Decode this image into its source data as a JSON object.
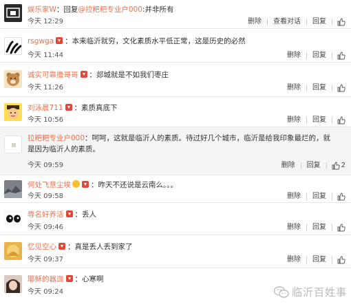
{
  "comments": [
    {
      "user": "娱乐家W",
      "vip": false,
      "separator": "：",
      "reply_prefix": "回复",
      "mention": "@拉粑粑专业户000",
      "text_after": ":并非所有",
      "time": "今天 12:29",
      "actions": [
        "删除",
        "查看对话",
        "回复"
      ],
      "likes": ""
    },
    {
      "user": "rsgwga",
      "vip": true,
      "separator": "：",
      "text": "本来临沂就穷，文化素质水平低正常，这是历史的必然",
      "time": "今天 11:44",
      "actions": [
        "删除",
        "回复"
      ],
      "likes": ""
    },
    {
      "user": "诚实可靠撸哥哥",
      "vip": true,
      "separator": "：",
      "text": "郯城就是不如我们枣庄",
      "time": "今天 11:26",
      "actions": [
        "删除",
        "回复"
      ],
      "likes": ""
    },
    {
      "user": "刘泳晨711",
      "vip": true,
      "separator": "：",
      "text": "素质真底下",
      "time": "今天 10:56",
      "actions": [
        "删除",
        "回复"
      ],
      "likes": ""
    },
    {
      "user": "拉粑粑专业户000",
      "vip": false,
      "separator": "：",
      "text": "呵呵，这就是临沂人的素质。待过好几个城市，临沂是给我印象最烂的，就是因为临沂人的素质。",
      "time": "今天 09:59",
      "actions": [
        "删除",
        "回复"
      ],
      "likes": "2"
    },
    {
      "user": "何处飞意尘埃",
      "vip": true,
      "emoji_badge": true,
      "separator": "：",
      "text": "昨天不还说是云南么。。。",
      "time": "今天 09:58",
      "actions": [
        "删除",
        "回复"
      ],
      "likes": ""
    },
    {
      "user": "辱名好养活",
      "vip": true,
      "separator": "：",
      "text": "丢人",
      "time": "今天 09:46",
      "actions": [
        "删除",
        "回复"
      ],
      "likes": ""
    },
    {
      "user": "忆见空心",
      "vip": true,
      "separator": "：",
      "text": "真是丢人丢到家了",
      "time": "今天 09:37",
      "actions": [
        "删除",
        "回复"
      ],
      "likes": ""
    },
    {
      "user": "耶稣的器皿",
      "vip": true,
      "separator": "：",
      "text": "心寒啊",
      "time": "今天 09:24",
      "actions": [],
      "likes": ""
    }
  ],
  "watermark": {
    "text": "临沂百姓事",
    "icon": "wechat-icon"
  },
  "colors": {
    "username": "#eb7350",
    "vip_badge": "#e0483a",
    "shaded_row": "#f5f5f5"
  }
}
